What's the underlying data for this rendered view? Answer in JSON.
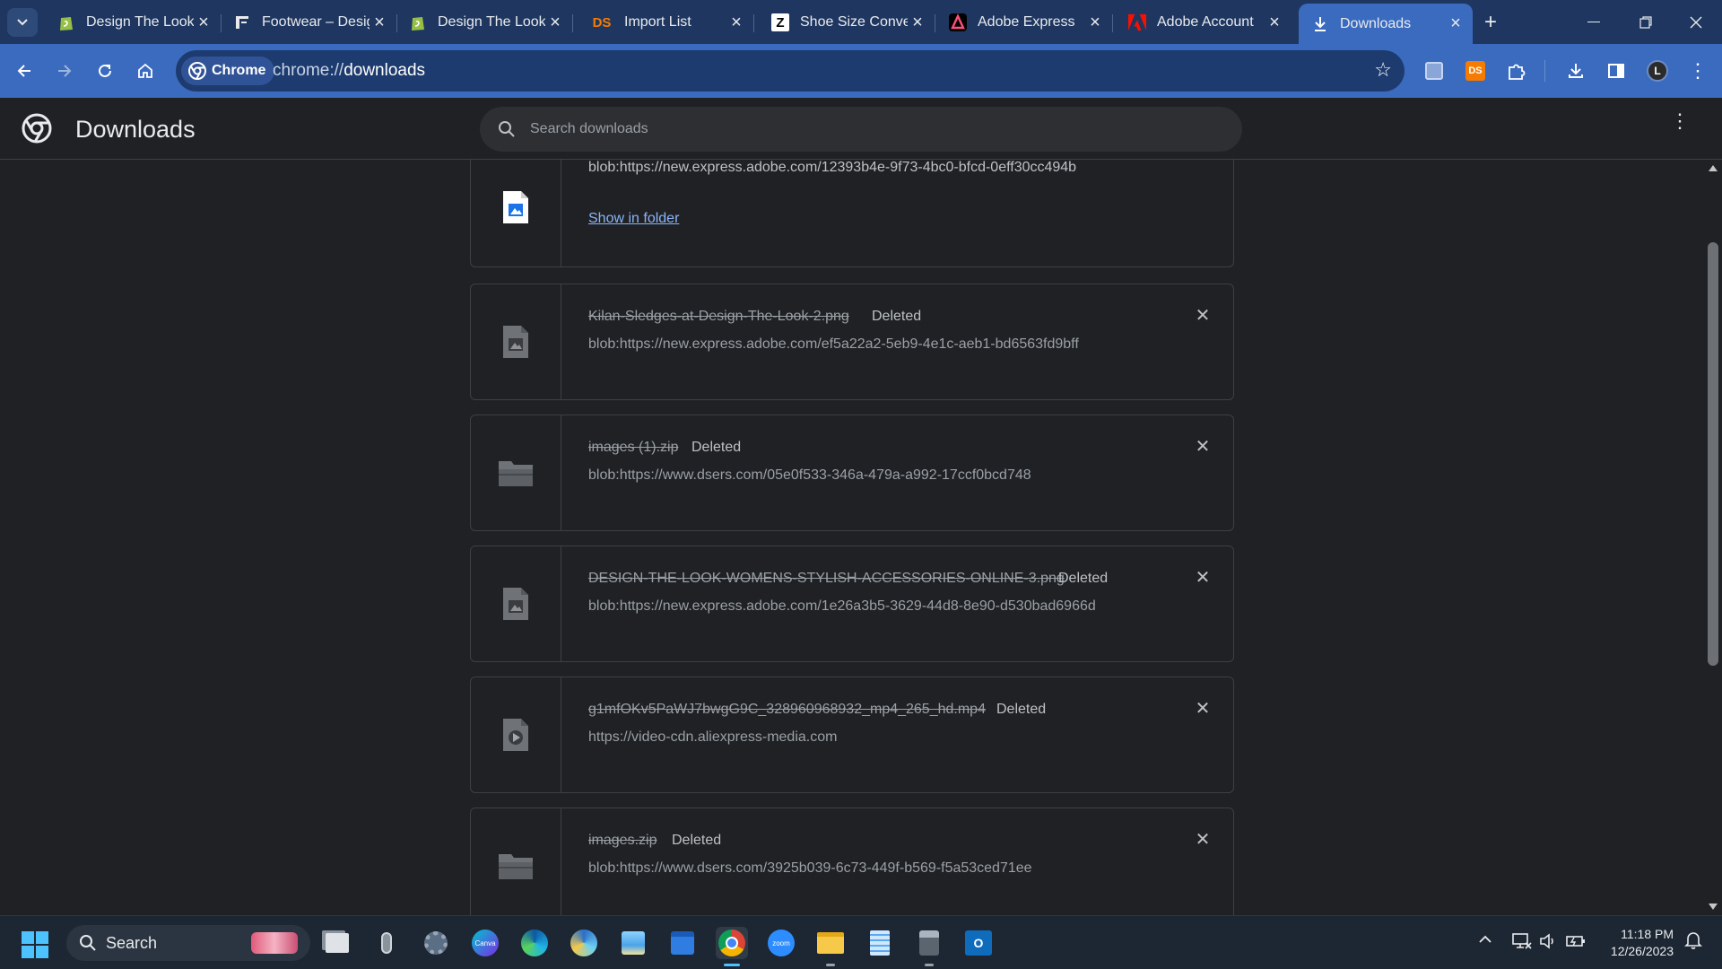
{
  "tabs": [
    {
      "title": "Design The Look",
      "favicon": "shopify-icon",
      "active": false
    },
    {
      "title": "Footwear – Desig",
      "favicon": "footwear-icon",
      "active": false
    },
    {
      "title": "Design The Look",
      "favicon": "shopify-icon",
      "active": false
    },
    {
      "title": "Import List",
      "favicon": "dsers-icon",
      "active": false
    },
    {
      "title": "Shoe Size Conve",
      "favicon": "z-icon",
      "active": false
    },
    {
      "title": "Adobe Express",
      "favicon": "adobe-express-icon",
      "active": false
    },
    {
      "title": "Adobe Account",
      "favicon": "adobe-icon",
      "active": false
    },
    {
      "title": "Downloads",
      "favicon": "download-icon",
      "active": true
    }
  ],
  "toolbar": {
    "chip_label": "Chrome",
    "url_scheme": "chrome://",
    "url_path": "downloads"
  },
  "page": {
    "title": "Downloads",
    "search_placeholder": "Search downloads"
  },
  "downloads": [
    {
      "filename": "",
      "status": "",
      "source": "blob:https://new.express.adobe.com/12393b4e-9f73-4bc0-bfcd-0eff30cc494b",
      "link": "Show in folder",
      "icon": "image-file-icon"
    },
    {
      "filename": "Kilan-Sledges-at-Design-The-Look-2.png",
      "status": "Deleted",
      "source": "blob:https://new.express.adobe.com/ef5a22a2-5eb9-4e1c-aeb1-bd6563fd9bff",
      "icon": "image-file-icon"
    },
    {
      "filename": "images (1).zip",
      "status": "Deleted",
      "source": "blob:https://www.dsers.com/05e0f533-346a-479a-a992-17ccf0bcd748",
      "icon": "folder-icon"
    },
    {
      "filename": "DESIGN-THE-LOOK-WOMENS-STYLISH-ACCESSORIES-ONLINE-3.png",
      "status": "Deleted",
      "source": "blob:https://new.express.adobe.com/1e26a3b5-3629-44d8-8e90-d530bad6966d",
      "icon": "image-file-icon"
    },
    {
      "filename": "g1mfOKv5PaWJ7bwgG9C_328960968932_mp4_265_hd.mp4",
      "status": "Deleted",
      "source": "https://video-cdn.aliexpress-media.com",
      "icon": "video-file-icon"
    },
    {
      "filename": "images.zip",
      "status": "Deleted",
      "source": "blob:https://www.dsers.com/3925b039-6c73-449f-b569-f5a53ced71ee",
      "icon": "folder-icon"
    }
  ],
  "taskbar": {
    "search_label": "Search",
    "time": "11:18 PM",
    "date": "12/26/2023"
  },
  "colors": {
    "tabstrip": "#1f3760",
    "toolbar": "#3b6bbf",
    "page_bg": "#202124",
    "link": "#8ab4f8"
  }
}
